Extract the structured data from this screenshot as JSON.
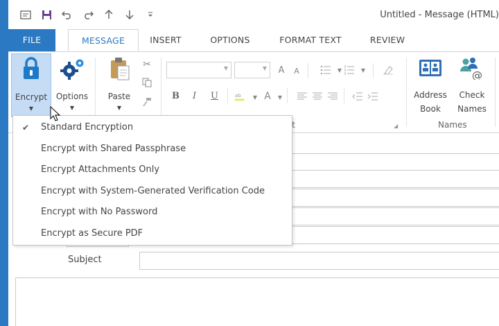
{
  "window": {
    "title": "Untitled - Message (HTML)"
  },
  "qat": {
    "icons": [
      "app-icon",
      "save-icon",
      "undo-icon",
      "redo-icon",
      "up-icon",
      "down-icon",
      "customize-icon"
    ]
  },
  "tabs": [
    {
      "label": "FILE"
    },
    {
      "label": "MESSAGE"
    },
    {
      "label": "INSERT"
    },
    {
      "label": "OPTIONS"
    },
    {
      "label": "FORMAT TEXT"
    },
    {
      "label": "REVIEW"
    }
  ],
  "ribbon": {
    "encrypt": {
      "label": "Encrypt"
    },
    "options": {
      "label": "Options"
    },
    "paste": {
      "label": "Paste"
    },
    "format": {
      "bold": "B",
      "italic": "I",
      "underline": "U"
    },
    "basic_text_group": {
      "label_fragment": "xt"
    },
    "address_book": {
      "label_line1": "Address",
      "label_line2": "Book"
    },
    "check_names": {
      "label_line1": "Check",
      "label_line2": "Names"
    },
    "names_group": {
      "label": "Names"
    }
  },
  "encrypt_menu": {
    "items": [
      {
        "label": "Standard Encryption",
        "checked": true
      },
      {
        "label": "Encrypt with Shared Passphrase",
        "checked": false
      },
      {
        "label": "Encrypt Attachments Only",
        "checked": false
      },
      {
        "label": "Encrypt with System-Generated Verification Code",
        "checked": false
      },
      {
        "label": "Encrypt with No Password",
        "checked": false
      },
      {
        "label": "Encrypt as Secure PDF",
        "checked": false
      }
    ],
    "check_mark": "✔"
  },
  "form": {
    "subject_label": "Subject"
  },
  "colors": {
    "accent": "#2b79c2",
    "encrypt_highlight": "#c5dcf4",
    "address_book_icon": "#2e6fb7",
    "check_names_icon": "#4aa3a0"
  }
}
